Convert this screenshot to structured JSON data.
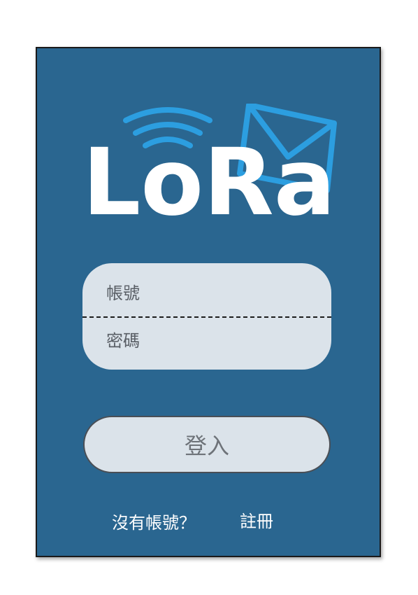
{
  "logo": {
    "text": "LoRa",
    "icons": [
      "wifi-signal-icon",
      "envelope-icon"
    ],
    "signal_color": "#2c9ee0",
    "envelope_color": "#2c9ee0"
  },
  "form": {
    "username_placeholder": "帳號",
    "password_placeholder": "密碼",
    "login_label": "登入"
  },
  "footer": {
    "no_account_text": "沒有帳號？",
    "register_label": "註冊"
  },
  "colors": {
    "background": "#2a6690",
    "field_background": "#dbe3ea",
    "text_white": "#ffffff"
  }
}
